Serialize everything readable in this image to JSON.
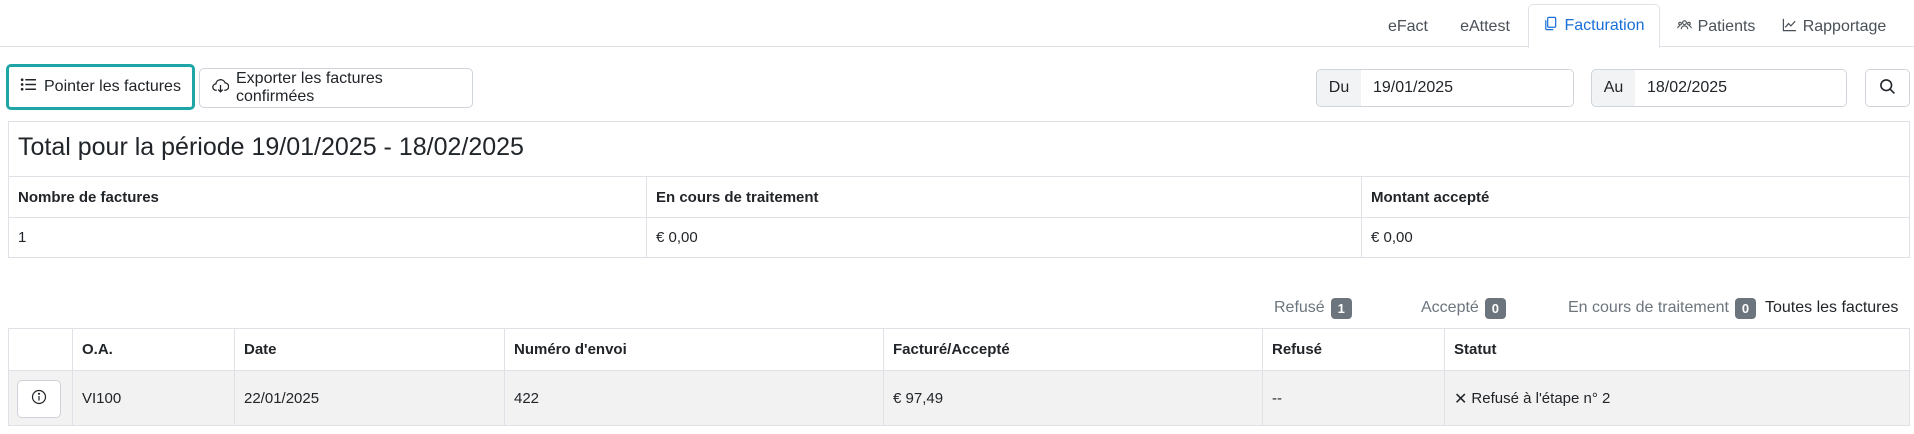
{
  "tabs": [
    {
      "label": "eFact",
      "icon": "",
      "active": false
    },
    {
      "label": "eAttest",
      "icon": "",
      "active": false
    },
    {
      "label": "Facturation",
      "icon": "copy-icon",
      "active": true
    },
    {
      "label": "Patients",
      "icon": "users-icon",
      "active": false
    },
    {
      "label": "Rapportage",
      "icon": "chart-line-icon",
      "active": false
    }
  ],
  "toolbar": {
    "point_label": "Pointer les factures",
    "export_label": "Exporter les factures confirmées",
    "from_label": "Du",
    "from_value": "19/01/2025",
    "to_label": "Au",
    "to_value": "18/02/2025"
  },
  "summary": {
    "title": "Total pour la période 19/01/2025 - 18/02/2025",
    "headers": [
      "Nombre de factures",
      "En cours de traitement",
      "Montant accepté"
    ],
    "values": [
      "1",
      "€ 0,00",
      "€ 0,00"
    ]
  },
  "filters": [
    {
      "label": "Refusé",
      "count": "1"
    },
    {
      "label": "Accepté",
      "count": "0"
    },
    {
      "label": "En cours de traitement",
      "count": "0"
    },
    {
      "label": "Toutes les factures",
      "count": null
    }
  ],
  "table": {
    "headers": [
      "",
      "O.A.",
      "Date",
      "Numéro d'envoi",
      "Facturé/Accepté",
      "Refusé",
      "Statut"
    ],
    "rows": [
      {
        "oa": "VI100",
        "date": "22/01/2025",
        "numero": "422",
        "facture": "€ 97,49",
        "refuse": "--",
        "statut": "Refusé à l'étape n° 2"
      }
    ]
  },
  "colors": {
    "accent": "#1a6fd6",
    "focus_ring": "#1ea6a6",
    "badge": "#6c757d",
    "row_bg": "#f2f2f2"
  }
}
